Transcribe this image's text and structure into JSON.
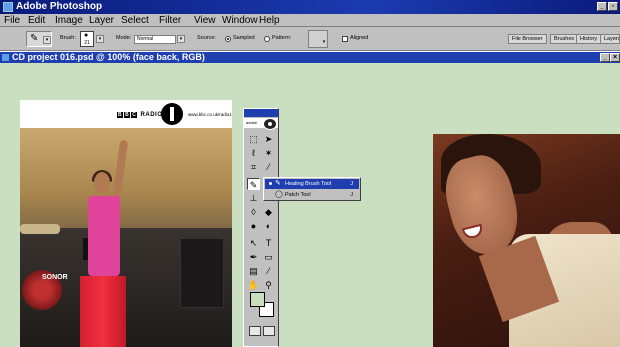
{
  "app": {
    "title": "Adobe Photoshop"
  },
  "menu": [
    "File",
    "Edit",
    "Image",
    "Layer",
    "Select",
    "Filter",
    "View",
    "Window",
    "Help"
  ],
  "options": {
    "brush_label": "Brush:",
    "brush_size": "21",
    "mode_label": "Mode:",
    "mode_value": "Normal",
    "source_label": "Source:",
    "sampled_label": "Sampled",
    "pattern_label": "Pattern:",
    "aligned_label": "Aligned",
    "palette_tabs": [
      "File Browser",
      "Brushes",
      "History",
      "Layers"
    ]
  },
  "document": {
    "title": "CD project 016.psd @ 100% (face back, RGB)"
  },
  "banner": {
    "brand_letters": [
      "B",
      "B",
      "C"
    ],
    "brand_word": "RADIO",
    "url": "www.bbc.co.uk/radio1"
  },
  "stage": {
    "drum_brand": "SONOR"
  },
  "toolbox": {
    "header": "adobe"
  },
  "flyout": {
    "items": [
      {
        "label": "Healing Brush Tool",
        "shortcut": "J",
        "icon": "healing-brush-icon",
        "selected": true
      },
      {
        "label": "Patch Tool",
        "shortcut": "J",
        "icon": "patch-icon",
        "selected": false
      }
    ]
  },
  "colors": {
    "canvas_bg": "#c9dfc0",
    "title_blue": "#1f3fb0",
    "chrome_gray": "#c0c0c0"
  }
}
